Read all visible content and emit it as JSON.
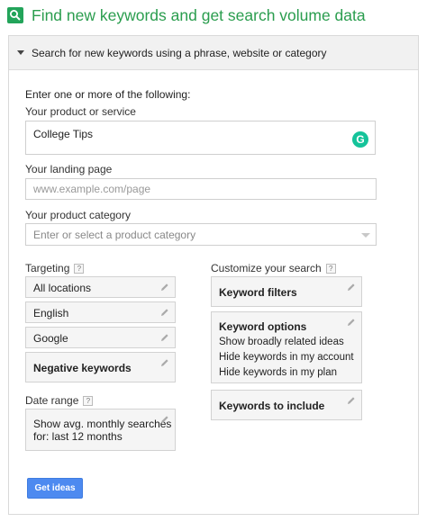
{
  "header": {
    "title": "Find new keywords and get search volume data",
    "icon": "search-icon",
    "icon_color": "#23a45a",
    "title_color": "#2a9d4e"
  },
  "section": {
    "label": "Search for new keywords using a phrase, website or category"
  },
  "form": {
    "intro": "Enter one or more of the following:",
    "product_label": "Your product or service",
    "product_value": "College Tips",
    "grammarly_badge": "G",
    "landing_label": "Your landing page",
    "landing_placeholder": "www.example.com/page",
    "category_label": "Your product category",
    "category_placeholder": "Enter or select a product category"
  },
  "targeting": {
    "label": "Targeting",
    "help": "?",
    "items": [
      "All locations",
      "English",
      "Google"
    ],
    "negative_keywords": "Negative keywords"
  },
  "date_range": {
    "label": "Date range",
    "help": "?",
    "line1": "Show avg. monthly searches",
    "line2": "for: last 12 months"
  },
  "customize": {
    "label": "Customize your search",
    "help": "?",
    "keyword_filters": "Keyword filters",
    "keyword_options": {
      "title": "Keyword options",
      "lines": [
        "Show broadly related ideas",
        "Hide keywords in my account",
        "Hide keywords in my plan"
      ]
    },
    "keywords_to_include": "Keywords to include"
  },
  "actions": {
    "get_ideas": "Get ideas",
    "button_color": "#4d8af0"
  }
}
